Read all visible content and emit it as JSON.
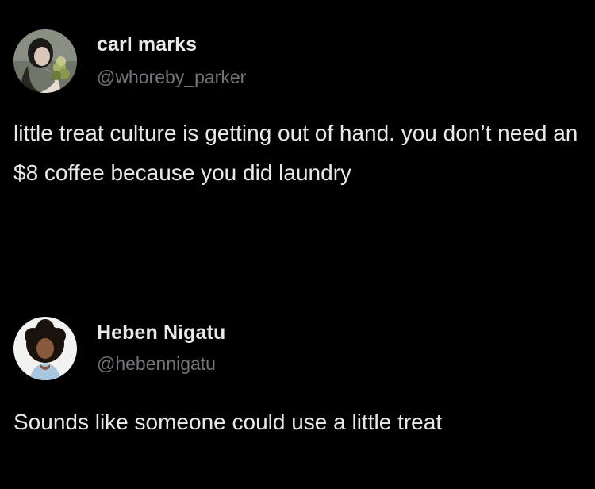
{
  "tweets": [
    {
      "name": "carl marks",
      "handle": "@whoreby_parker",
      "text": "little treat culture is getting out of hand. you don’t need an $8 coffee because you did laundry",
      "avatar_icon": "profile-photo-woman-with-plant"
    },
    {
      "name": "Heben Nigatu",
      "handle": "@hebennigatu",
      "text": "Sounds like someone could use a little treat",
      "avatar_icon": "profile-photo-woman-curly-hair"
    }
  ],
  "colors": {
    "background": "#000000",
    "name_text": "#e7e9ea",
    "handle_text": "#71767b",
    "body_text": "#e7e9ea"
  }
}
